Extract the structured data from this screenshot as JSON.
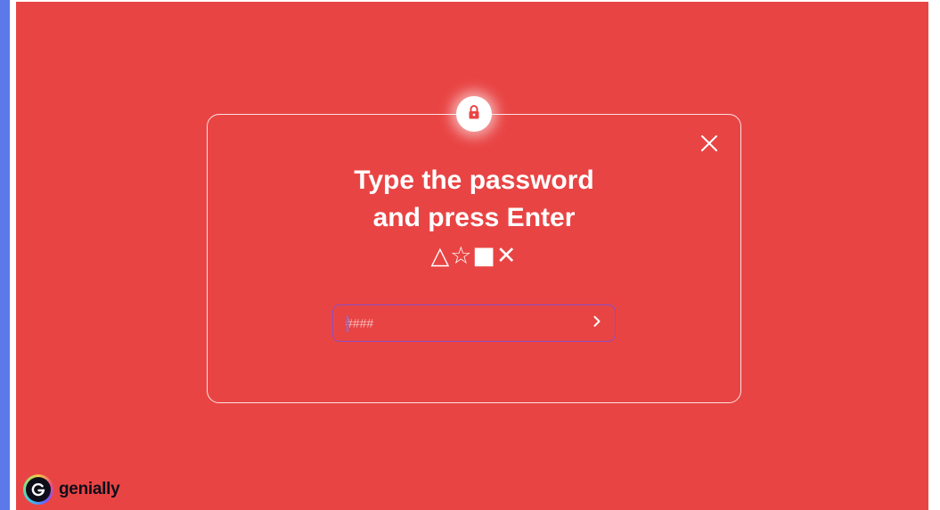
{
  "dialog": {
    "title_line1": "Type the password",
    "title_line2": "and press Enter",
    "symbols": "△☆■✕",
    "password_placeholder": "####",
    "password_value": "",
    "lock_icon": "lock-icon",
    "close_icon": "close-icon",
    "submit_icon": "chevron-right-icon"
  },
  "brand": {
    "name": "genially",
    "logo_letter": "G"
  },
  "colors": {
    "background": "#e94444",
    "card_border": "#fbe2e2",
    "input_border": "#8a4fc4",
    "side_bar": "#5b79e8"
  }
}
